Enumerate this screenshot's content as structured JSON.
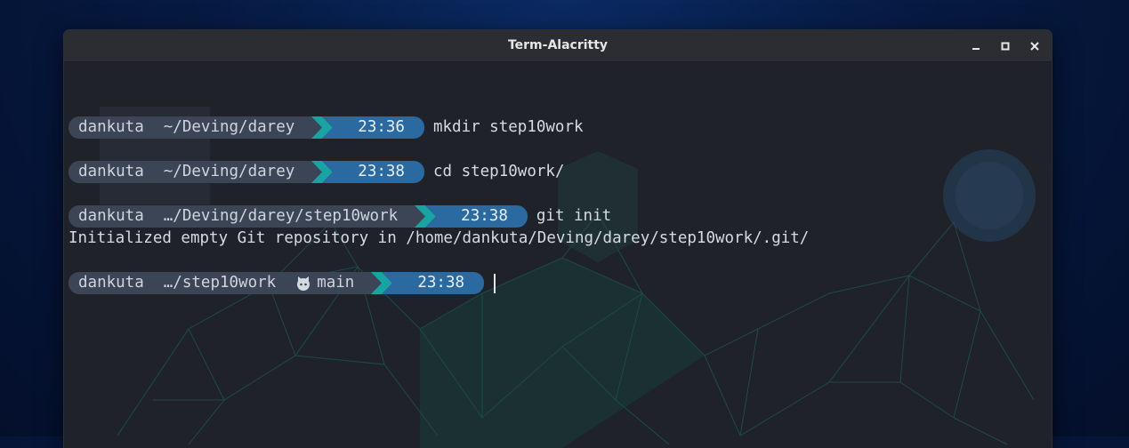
{
  "window": {
    "title": "Term-Alacritty"
  },
  "colors": {
    "segment": "#3b4556",
    "time": "#2a6aa0",
    "accent_teal": "#1aa3a3",
    "accent_blue": "#2e74b5"
  },
  "prompts": [
    {
      "user": "dankuta",
      "path": "~/Deving/darey",
      "time": "23:36",
      "command": "mkdir step10work"
    },
    {
      "user": "dankuta",
      "path": "~/Deving/darey",
      "time": "23:38",
      "command": "cd step10work/"
    },
    {
      "user": "dankuta",
      "path": "…/Deving/darey/step10work",
      "time": "23:38",
      "command": "git init"
    },
    {
      "user": "dankuta",
      "path": "…/step10work",
      "git_icon": "github-icon",
      "branch": "main",
      "time": "23:38",
      "command": ""
    }
  ],
  "output": {
    "git_init": "Initialized empty Git repository in /home/dankuta/Deving/darey/step10work/.git/"
  }
}
